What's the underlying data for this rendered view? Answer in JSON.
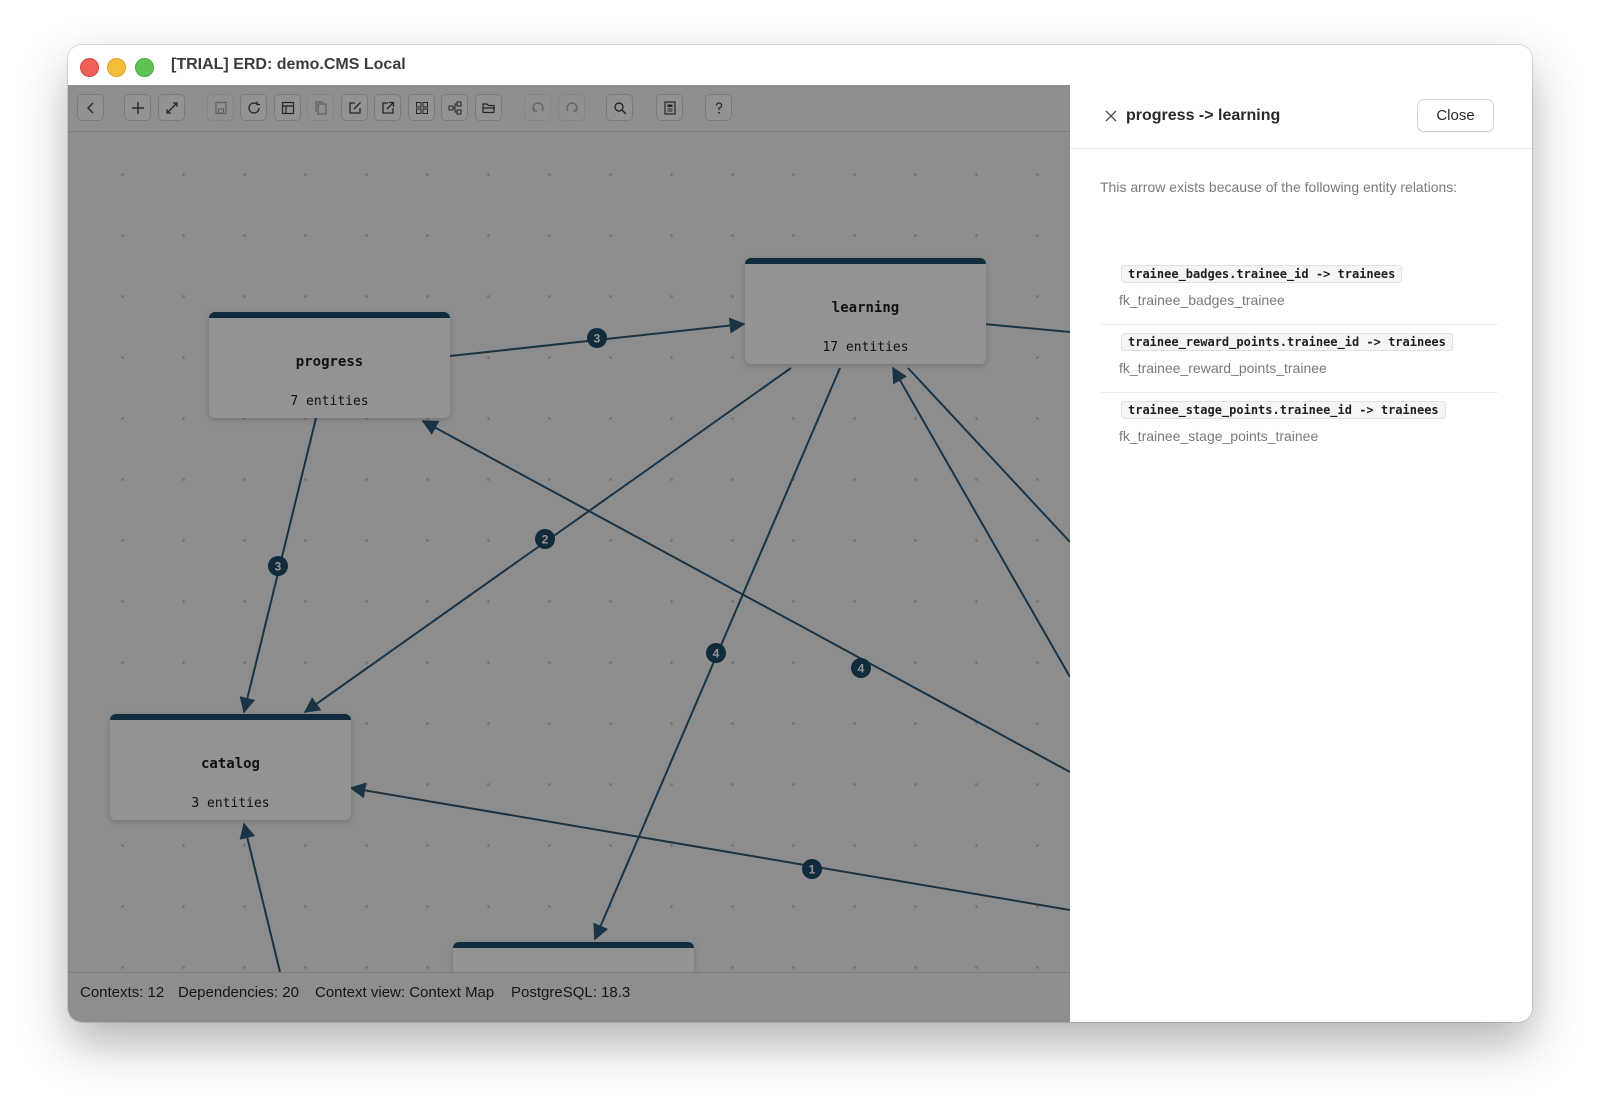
{
  "window": {
    "title": "[TRIAL] ERD: demo.CMS Local"
  },
  "toolbar": {
    "buttons": [
      {
        "icon": "back-icon",
        "disabled": false
      },
      {
        "icon": "add-icon",
        "disabled": false
      },
      {
        "icon": "link-icon",
        "disabled": false
      },
      {
        "icon": "save-icon",
        "disabled": true
      },
      {
        "icon": "refresh-icon",
        "disabled": false
      },
      {
        "icon": "table-icon",
        "disabled": false
      },
      {
        "icon": "copy-icon",
        "disabled": true
      },
      {
        "icon": "edit-icon",
        "disabled": false
      },
      {
        "icon": "export-icon",
        "disabled": false
      },
      {
        "icon": "grid-icon",
        "disabled": false
      },
      {
        "icon": "diagram-icon",
        "disabled": false
      },
      {
        "icon": "folder-icon",
        "disabled": false
      },
      {
        "icon": "undo-icon",
        "disabled": true
      },
      {
        "icon": "redo-icon",
        "disabled": true
      },
      {
        "icon": "search-icon",
        "disabled": false
      },
      {
        "icon": "document-icon",
        "disabled": false
      },
      {
        "icon": "help-icon",
        "disabled": false
      }
    ]
  },
  "diagram": {
    "nodes": [
      {
        "id": "progress",
        "name": "progress",
        "count": "7 entities"
      },
      {
        "id": "learning",
        "name": "learning",
        "count": "17 entities"
      },
      {
        "id": "catalog",
        "name": "catalog",
        "count": "3 entities"
      },
      {
        "id": "bottom",
        "name": "",
        "count": ""
      }
    ],
    "edges": [
      {
        "from": "progress",
        "to": "learning",
        "label": "3"
      },
      {
        "from": "progress",
        "to": "catalog",
        "label": "3"
      },
      {
        "from": "learning",
        "to": "catalog",
        "label": "2"
      },
      {
        "from": "learning",
        "to": "bottom",
        "label": "4"
      },
      {
        "from": "progress",
        "to": "offscreen-right",
        "label": "4"
      },
      {
        "from": "catalog",
        "to": "offscreen-right",
        "label": "1"
      }
    ]
  },
  "statusbar": {
    "contexts": "Contexts: 12",
    "dependencies": "Dependencies: 20",
    "context_view": "Context view: Context Map",
    "postgres": "PostgreSQL: 18.3"
  },
  "panel": {
    "title": "progress -> learning",
    "close_label": "Close",
    "description": "This arrow exists because of the following entity relations:",
    "relations": [
      {
        "code": "trainee_badges.trainee_id -> trainees",
        "fk": "fk_trainee_badges_trainee"
      },
      {
        "code": "trainee_reward_points.trainee_id -> trainees",
        "fk": "fk_trainee_reward_points_trainee"
      },
      {
        "code": "trainee_stage_points.trainee_id -> trainees",
        "fk": "fk_trainee_stage_points_trainee"
      }
    ]
  },
  "colors": {
    "edge": "#2e5b78",
    "node_header": "#1d4b66",
    "badge": "#1d4b66",
    "overlay": "rgba(0,0,0,0.42)"
  }
}
